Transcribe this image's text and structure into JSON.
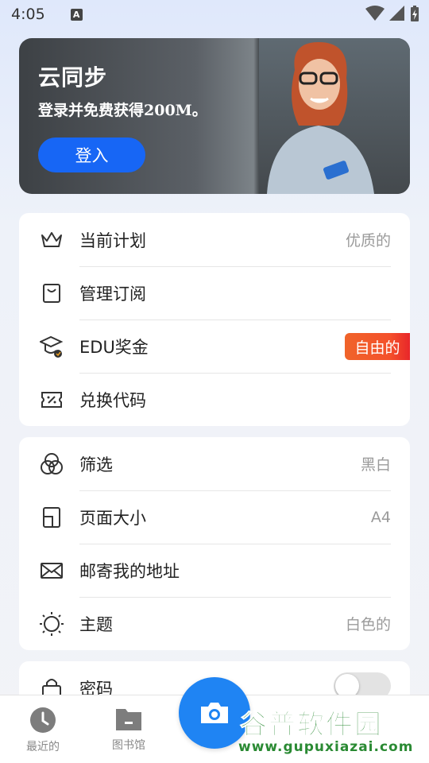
{
  "status_bar": {
    "time": "4:05",
    "notification_icon": "A"
  },
  "banner": {
    "title": "云同步",
    "subtitle": "登录并免费获得200M。",
    "login_label": "登入"
  },
  "account_card": {
    "items": [
      {
        "icon": "crown-icon",
        "label": "当前计划",
        "value": "优质的"
      },
      {
        "icon": "shopping-bag-icon",
        "label": "管理订阅",
        "value": ""
      },
      {
        "icon": "graduation-cap-icon",
        "label": "EDU奖金",
        "badge": "自由的"
      },
      {
        "icon": "ticket-icon",
        "label": "兑换代码",
        "value": ""
      }
    ]
  },
  "settings_card": {
    "items": [
      {
        "icon": "filter-circles-icon",
        "label": "筛选",
        "value": "黑白"
      },
      {
        "icon": "page-size-icon",
        "label": "页面大小",
        "value": "A4"
      },
      {
        "icon": "envelope-icon",
        "label": "邮寄我的地址",
        "value": ""
      },
      {
        "icon": "sun-icon",
        "label": "主题",
        "value": "白色的"
      }
    ]
  },
  "security_card": {
    "items": [
      {
        "icon": "lock-icon",
        "label": "密码",
        "toggle_on": false
      }
    ]
  },
  "bottom_nav": {
    "items": [
      {
        "icon": "clock-icon",
        "label": "最近的"
      },
      {
        "icon": "folder-icon",
        "label": "图书馆"
      }
    ],
    "fab_icon": "camera-icon"
  },
  "watermark": {
    "title": "谷普软件园",
    "url": "www.gupuxiazai.com"
  }
}
